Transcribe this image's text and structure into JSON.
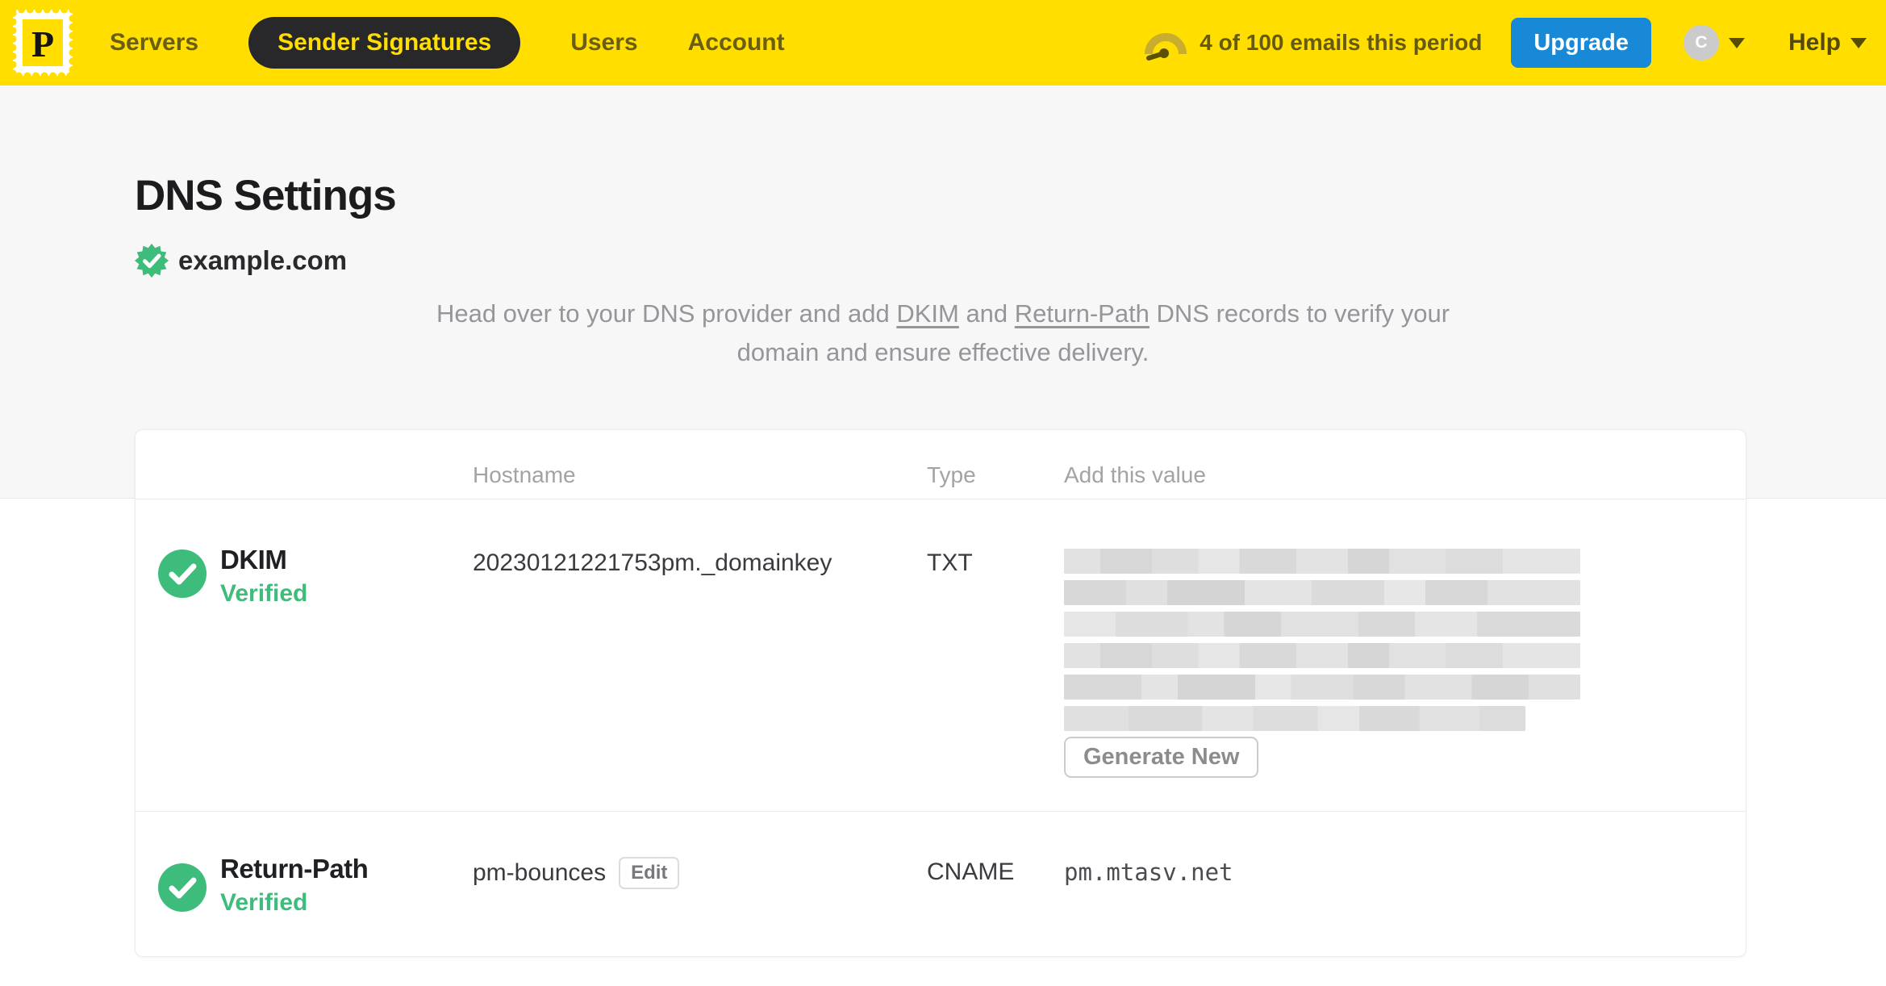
{
  "topbar": {
    "logo_letter": "P",
    "nav": [
      {
        "label": "Servers",
        "active": false
      },
      {
        "label": "Sender Signatures",
        "active": true
      },
      {
        "label": "Users",
        "active": false
      },
      {
        "label": "Account",
        "active": false
      }
    ],
    "usage_text": "4 of 100 emails this period",
    "upgrade_label": "Upgrade",
    "avatar_initial": "C",
    "help_label": "Help"
  },
  "page": {
    "title": "DNS Settings",
    "domain": "example.com",
    "description": {
      "part1": "Head over to your DNS provider and add ",
      "link_dkim": "DKIM",
      "part2": " and ",
      "link_return_path": "Return-Path",
      "part3": " DNS records to verify your domain and ensure effective delivery."
    }
  },
  "table": {
    "headers": {
      "hostname": "Hostname",
      "type": "Type",
      "value": "Add this value"
    },
    "rows": [
      {
        "name": "DKIM",
        "status": "Verified",
        "hostname": "20230121221753pm._domainkey",
        "type": "TXT",
        "value_redacted": true,
        "action_label": "Generate New"
      },
      {
        "name": "Return-Path",
        "status": "Verified",
        "hostname": "pm-bounces",
        "hostname_action": "Edit",
        "type": "CNAME",
        "value": "pm.mtasv.net"
      }
    ]
  },
  "icons": {
    "logo": "postmark-stamp",
    "usage": "gauge",
    "domain_badge": "verified-seal",
    "row_status": "check-circle",
    "menus": "caret-down"
  },
  "colors": {
    "brand_yellow": "#FFDE00",
    "upgrade_blue": "#1789D6",
    "success_green": "#3EBC7B",
    "active_pill": "#28282A"
  }
}
